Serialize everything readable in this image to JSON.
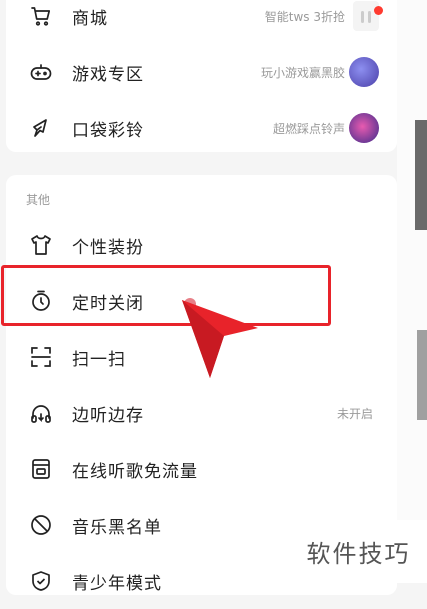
{
  "top_menu": {
    "items": [
      {
        "label": "商城",
        "sub": "智能tws 3折抢",
        "icon": "cart-icon"
      },
      {
        "label": "游戏专区",
        "sub": "玩小游戏赢黑胶",
        "icon": "gamepad-icon"
      },
      {
        "label": "口袋彩铃",
        "sub": "超燃踩点铃声",
        "icon": "ringtone-icon"
      }
    ]
  },
  "other_section": {
    "title": "其他",
    "items": [
      {
        "label": "个性装扮",
        "icon": "tshirt-icon"
      },
      {
        "label": "定时关闭",
        "icon": "timer-icon"
      },
      {
        "label": "扫一扫",
        "icon": "scan-icon"
      },
      {
        "label": "边听边存",
        "sub": "未开启",
        "icon": "headphones-icon"
      },
      {
        "label": "在线听歌免流量",
        "icon": "sim-card-icon"
      },
      {
        "label": "音乐黑名单",
        "icon": "block-icon"
      },
      {
        "label": "青少年模式",
        "icon": "shield-icon"
      }
    ]
  },
  "watermark": {
    "text": "软件技巧"
  },
  "colors": {
    "highlight": "#e8232a",
    "badge": "#ff3b30"
  }
}
